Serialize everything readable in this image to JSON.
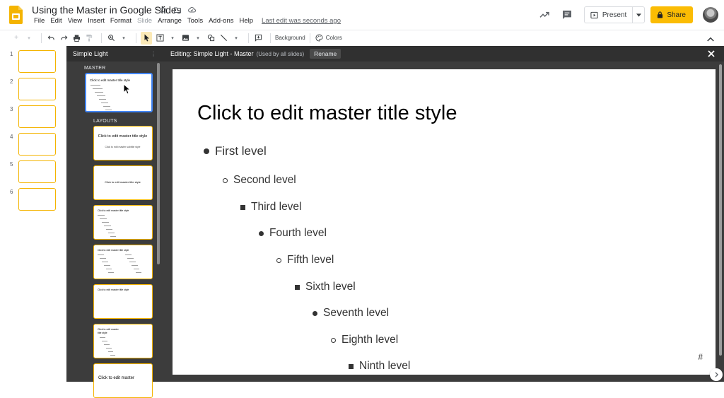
{
  "document": {
    "title": "Using the Master in Google Slides"
  },
  "menu": {
    "items": [
      "File",
      "Edit",
      "View",
      "Insert",
      "Format",
      "Slide",
      "Arrange",
      "Tools",
      "Add-ons",
      "Help"
    ],
    "disabled": [
      "Slide"
    ],
    "last_edit": "Last edit was seconds ago"
  },
  "header_actions": {
    "present_label": "Present",
    "share_label": "Share"
  },
  "toolbar": {
    "background_label": "Background",
    "colors_label": "Colors"
  },
  "filmstrip": {
    "slides": [
      "1",
      "2",
      "3",
      "4",
      "5",
      "6"
    ]
  },
  "master_panel": {
    "theme_name": "Simple Light",
    "master_section_label": "MASTER",
    "layouts_section_label": "LAYOUTS",
    "master_thumb_title": "Click to edit master title style",
    "layout_thumbs": [
      {
        "title": "Click to edit master title style",
        "subtitle": "Click to edit master subtitle style"
      },
      {
        "title": "Click to edit master title style",
        "subtitle": ""
      },
      {
        "title": "Click to edit master title style",
        "subtitle": ""
      },
      {
        "title": "Click to edit master title style",
        "subtitle": ""
      },
      {
        "title": "Click to edit master title style",
        "subtitle": ""
      },
      {
        "title": "Click to edit master title style",
        "subtitle": ""
      },
      {
        "title": "Click to edit master",
        "subtitle": ""
      }
    ]
  },
  "editor": {
    "heading": "Editing: Simple Light - Master",
    "subheading": "(Used by all slides)",
    "rename_label": "Rename"
  },
  "slide": {
    "title": "Click to edit master title style",
    "levels": [
      "First level",
      "Second level",
      "Third level",
      "Fourth level",
      "Fifth level",
      "Sixth level",
      "Seventh level",
      "Eighth level",
      "Ninth level"
    ],
    "slide_number": "#"
  },
  "colors": {
    "accent": "#fbbc04",
    "thumb_border": "#f4b400",
    "selected": "#4285f4",
    "panel": "#3c3c3c"
  }
}
